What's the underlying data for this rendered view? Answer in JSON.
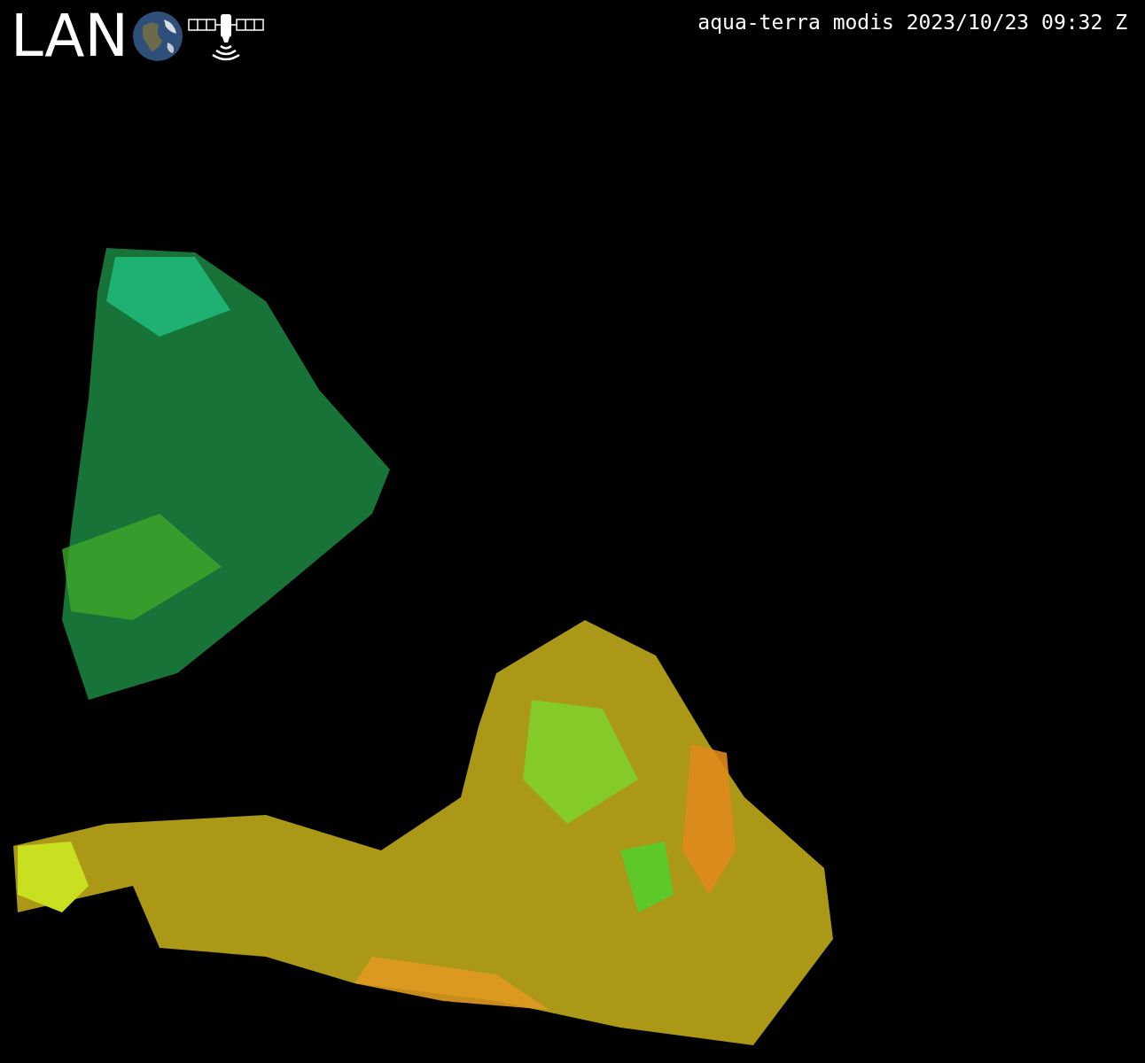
{
  "logo": {
    "text": "LAN"
  },
  "header": {
    "title": "aqua-terra modis 2023/10/23 09:32 Z"
  }
}
